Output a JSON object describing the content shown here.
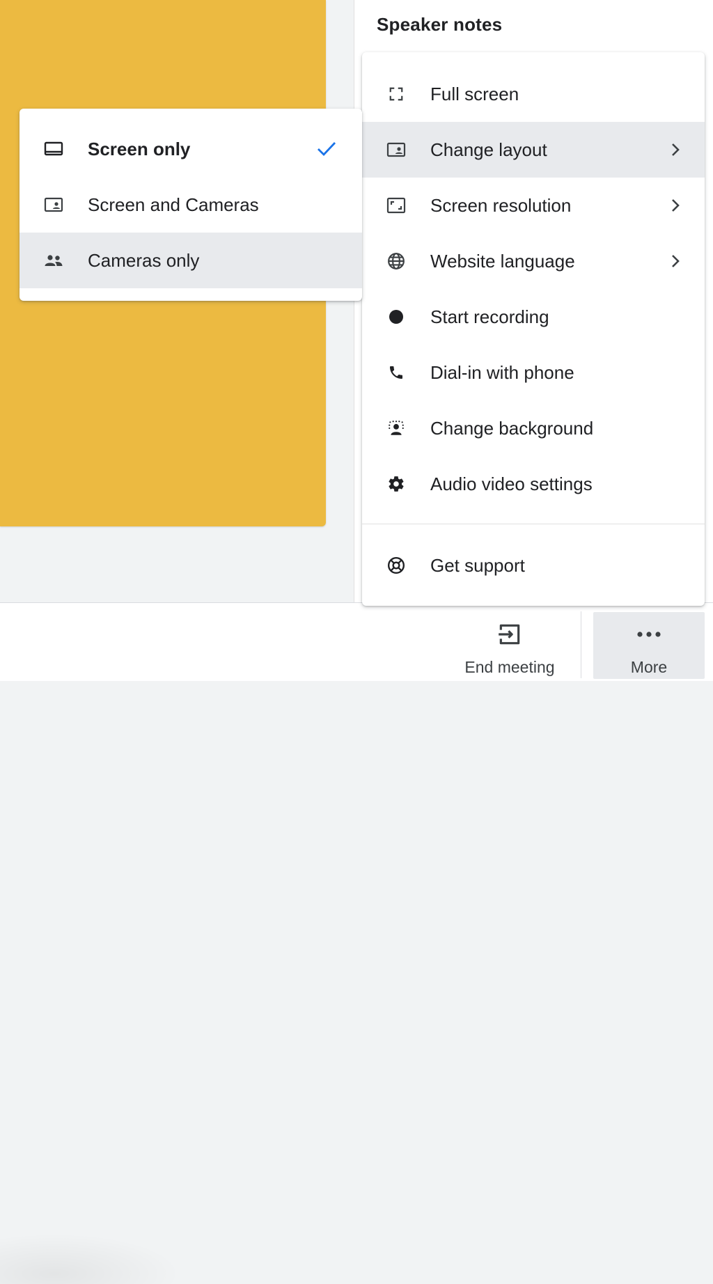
{
  "side_panel": {
    "title": "Speaker notes"
  },
  "main_menu": {
    "items": [
      {
        "label": "Full screen",
        "icon": "fullscreen-icon"
      },
      {
        "label": "Change layout",
        "icon": "layout-icon"
      },
      {
        "label": "Screen resolution",
        "icon": "resolution-icon"
      },
      {
        "label": "Website language",
        "icon": "globe-icon"
      },
      {
        "label": "Start recording",
        "icon": "record-icon"
      },
      {
        "label": "Dial-in with phone",
        "icon": "phone-icon"
      },
      {
        "label": "Change background",
        "icon": "background-icon"
      },
      {
        "label": "Audio video settings",
        "icon": "gear-icon"
      }
    ],
    "support": {
      "label": "Get support",
      "icon": "lifebuoy-icon"
    }
  },
  "layout_submenu": {
    "items": [
      {
        "label": "Screen only",
        "icon": "laptop-icon",
        "selected": true
      },
      {
        "label": "Screen and Cameras",
        "icon": "screen-camera-icon",
        "selected": false
      },
      {
        "label": "Cameras only",
        "icon": "people-icon",
        "selected": false
      }
    ]
  },
  "bottom_bar": {
    "end_meeting": {
      "label": "End meeting",
      "icon": "exit-icon"
    },
    "more": {
      "label": "More",
      "icon": "more-dots-icon"
    }
  },
  "colors": {
    "slide": "#ecba41",
    "check": "#1a73e8",
    "hover": "#e8eaed",
    "text": "#202124"
  }
}
